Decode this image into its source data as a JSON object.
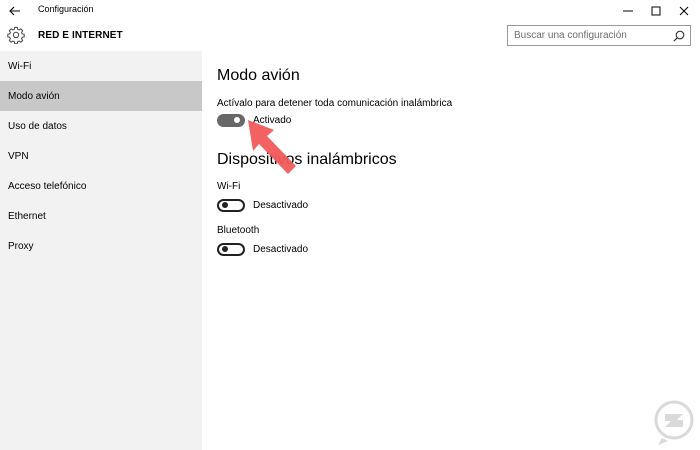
{
  "window": {
    "title": "Configuración",
    "back_icon": "back-arrow-icon",
    "controls": [
      "minimize-icon",
      "maximize-icon",
      "close-icon"
    ]
  },
  "header": {
    "section_title": "RED E INTERNET",
    "icon": "gear-icon",
    "search_placeholder": "Buscar una configuración"
  },
  "sidebar": {
    "items": [
      {
        "label": "Wi-Fi",
        "selected": false
      },
      {
        "label": "Modo avión",
        "selected": true
      },
      {
        "label": "Uso de datos",
        "selected": false
      },
      {
        "label": "VPN",
        "selected": false
      },
      {
        "label": "Acceso telefónico",
        "selected": false
      },
      {
        "label": "Ethernet",
        "selected": false
      },
      {
        "label": "Proxy",
        "selected": false
      }
    ]
  },
  "main": {
    "airplane": {
      "heading": "Modo avión",
      "description": "Actívalo para detener toda comunicación inalámbrica",
      "toggle_state": "Activado",
      "on": true
    },
    "wireless": {
      "heading": "Dispositivos inalámbricos",
      "wifi_label": "Wi-Fi",
      "wifi_state": "Desactivado",
      "wifi_on": false,
      "bluetooth_label": "Bluetooth",
      "bluetooth_state": "Desactivado",
      "bluetooth_on": false
    }
  },
  "colors": {
    "sidebar_bg": "#f2f2f2",
    "selected_bg": "#c8c8c8",
    "toggle_on": "#686868",
    "annotation_arrow": "#f25a5a"
  }
}
